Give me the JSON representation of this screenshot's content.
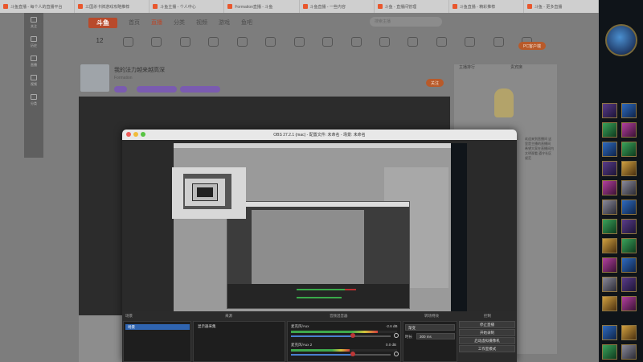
{
  "browser": {
    "tabs": [
      "斗鱼直播 - 每个人的直播平台",
      "三国杀卡牌游戏攻略推荐",
      "斗鱼主播 - 个人中心",
      "Formation直播 - 斗鱼",
      "斗鱼直播 - 一些内容",
      "斗鱼 - 直播间管理",
      "斗鱼直播 - 精彩推荐",
      "斗鱼 - 更多直播"
    ]
  },
  "site": {
    "logo": "斗鱼",
    "nav": [
      "首页",
      "直播",
      "分类",
      "视频",
      "游戏",
      "鱼吧"
    ],
    "search_placeholder": "搜索主播",
    "categories": [
      "12",
      "",
      "",
      "",
      "",
      "",
      "",
      "",
      "",
      "",
      "",
      "",
      "",
      "",
      "",
      "",
      "",
      ""
    ],
    "pc_button": "PC客户端",
    "channel_title": "我的法力越来越高深",
    "channel_meta": "Formation",
    "follow_button": "关注",
    "leftnav": [
      "关注",
      "历史",
      "直播",
      "视频",
      "分类"
    ],
    "right_tabs": [
      "主播排行",
      "贵宾席"
    ],
    "right_text": "欢迎来到直播间 这里是主播的直播间 希望大家在直播间内文明观看 遵守社区规范"
  },
  "obs": {
    "title": "OBS 27.2.1 (mac) - 配置文件: 未命名 - 场景: 未命名",
    "docks": {
      "scenes_header": "场景",
      "sources_header": "来源",
      "mixer_header": "音频混音器",
      "transitions_header": "转场特效",
      "controls_header": "控制"
    },
    "scenes": [
      "场景"
    ],
    "sources": [
      "显示器采集"
    ],
    "mixer": [
      {
        "name": "麦克风/Aux",
        "db": "-2.6 dB",
        "level": 0.82,
        "volume": 0.62
      },
      {
        "name": "麦克风/Aux 2",
        "db": "0.0 dB",
        "level": 0.55,
        "volume": 0.62
      }
    ],
    "transition": {
      "type": "渐变",
      "duration_label": "时长",
      "duration": "300 ms"
    },
    "controls": [
      "停止直播",
      "开始录制",
      "启动虚拟摄像机",
      "工作室模式"
    ]
  }
}
